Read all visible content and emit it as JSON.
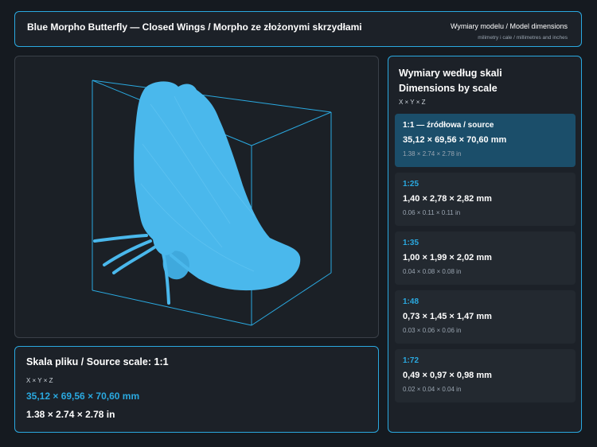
{
  "header": {
    "title": "Blue Morpho Butterfly — Closed Wings / Morpho ze złożonymi skrzydłami",
    "subtitle": "Wymiary modelu / Model dimensions",
    "caption": "milimetry i cale / millimetres and inches"
  },
  "source": {
    "heading": "Skala pliku / Source scale: 1:1",
    "axes": "X × Y × Z",
    "mm": "35,12 × 69,56 × 70,60 mm",
    "inches": "1.38 × 2.74 × 2.78 in"
  },
  "dims": {
    "heading_pl": "Wymiary według skali",
    "heading_en": "Dimensions by scale",
    "axes": "X × Y × Z",
    "scales": [
      {
        "ratio": "1:1  —  źródłowa / source",
        "mm": "35,12 × 69,56 × 70,60 mm",
        "inches": "1.38 × 2.74 × 2.78 in"
      },
      {
        "ratio": "1:25",
        "mm": "1,40 × 2,78 × 2,82 mm",
        "inches": "0.06 × 0.11 × 0.11 in"
      },
      {
        "ratio": "1:35",
        "mm": "1,00 × 1,99 × 2,02 mm",
        "inches": "0.04 × 0.08 × 0.08 in"
      },
      {
        "ratio": "1:48",
        "mm": "0,73 × 1,45 × 1,47 mm",
        "inches": "0.03 × 0.06 × 0.06 in"
      },
      {
        "ratio": "1:72",
        "mm": "0,49 × 0,97 × 0,98 mm",
        "inches": "0.02 × 0.04 × 0.04 in"
      }
    ]
  },
  "colors": {
    "accent": "#2aa9e0",
    "model": "#4ab8ec",
    "active_card": "#1b4e6a"
  }
}
